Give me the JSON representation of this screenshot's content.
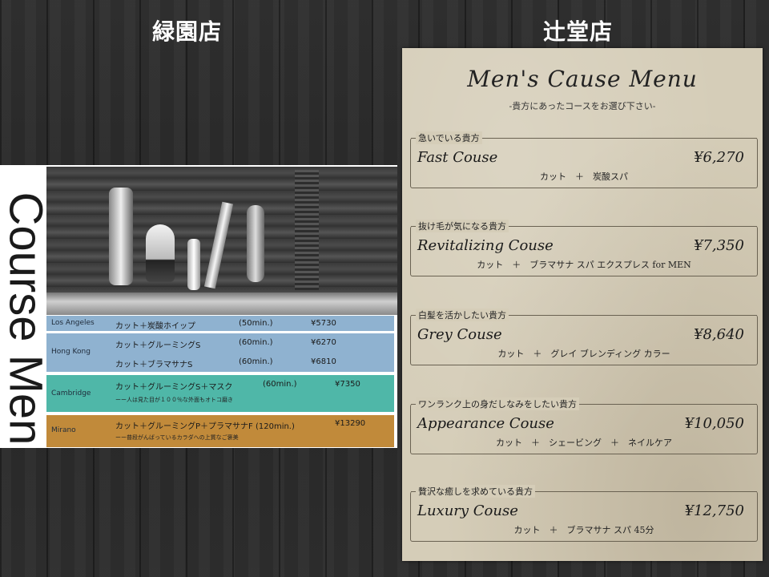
{
  "titles": {
    "left": "緑園店",
    "right": "辻堂店"
  },
  "left_card": {
    "vertical_title": "Course Menu",
    "rows": {
      "la": {
        "city": "Los Angeles",
        "line": "カット＋炭酸ホイップ",
        "duration": "(50min.)",
        "price": "¥5730"
      },
      "hk": {
        "city": "Hong Kong",
        "line1": "カット＋グルーミングS",
        "duration1": "(60min.)",
        "price1": "¥6270",
        "line2": "カット＋ブラマサナS",
        "duration2": "(60min.)",
        "price2": "¥6810"
      },
      "cam": {
        "city": "Cambridge",
        "line": "カット＋グルーミングS＋マスク",
        "duration": "(60min.)",
        "price": "¥7350",
        "sub": "ーー人は見た目が１００％な外面もオトコ磨き"
      },
      "mil": {
        "city": "Mirano",
        "line": "カット＋グルーミングP＋プラマサナF (120min.)",
        "price": "¥13290",
        "sub": "ーー普段がんばっているカラダへの上質なご褒美"
      }
    },
    "colors": {
      "la": "#8fb2d0",
      "hk": "#8fb2d0",
      "cam": "#4fb7a8",
      "mil": "#c18a3a"
    }
  },
  "menu": {
    "title": "Men's Cause Menu",
    "subtitle": "-貴方にあったコースをお選び下さい-",
    "courses": [
      {
        "label": "急いでいる貴方",
        "name": "Fast Couse",
        "price": "¥6,270",
        "desc": "カット　＋　炭酸スパ"
      },
      {
        "label": "抜け毛が気になる貴方",
        "name": "Revitalizing Couse",
        "price": "¥7,350",
        "desc": "カット　＋　ブラマサナ スパ エクスプレス for MEN"
      },
      {
        "label": "白髪を活かしたい貴方",
        "name": "Grey Couse",
        "price": "¥8,640",
        "desc": "カット　＋　グレイ ブレンディング カラー"
      },
      {
        "label": "ワンランク上の身だしなみをしたい貴方",
        "name": "Appearance Couse",
        "price": "¥10,050",
        "desc": "カット　＋　シェービング　＋　ネイルケア"
      },
      {
        "label": "贅沢な癒しを求めている貴方",
        "name": "Luxury Couse",
        "price": "¥12,750",
        "desc": "カット　＋　ブラマサナ スパ 45分"
      }
    ]
  }
}
